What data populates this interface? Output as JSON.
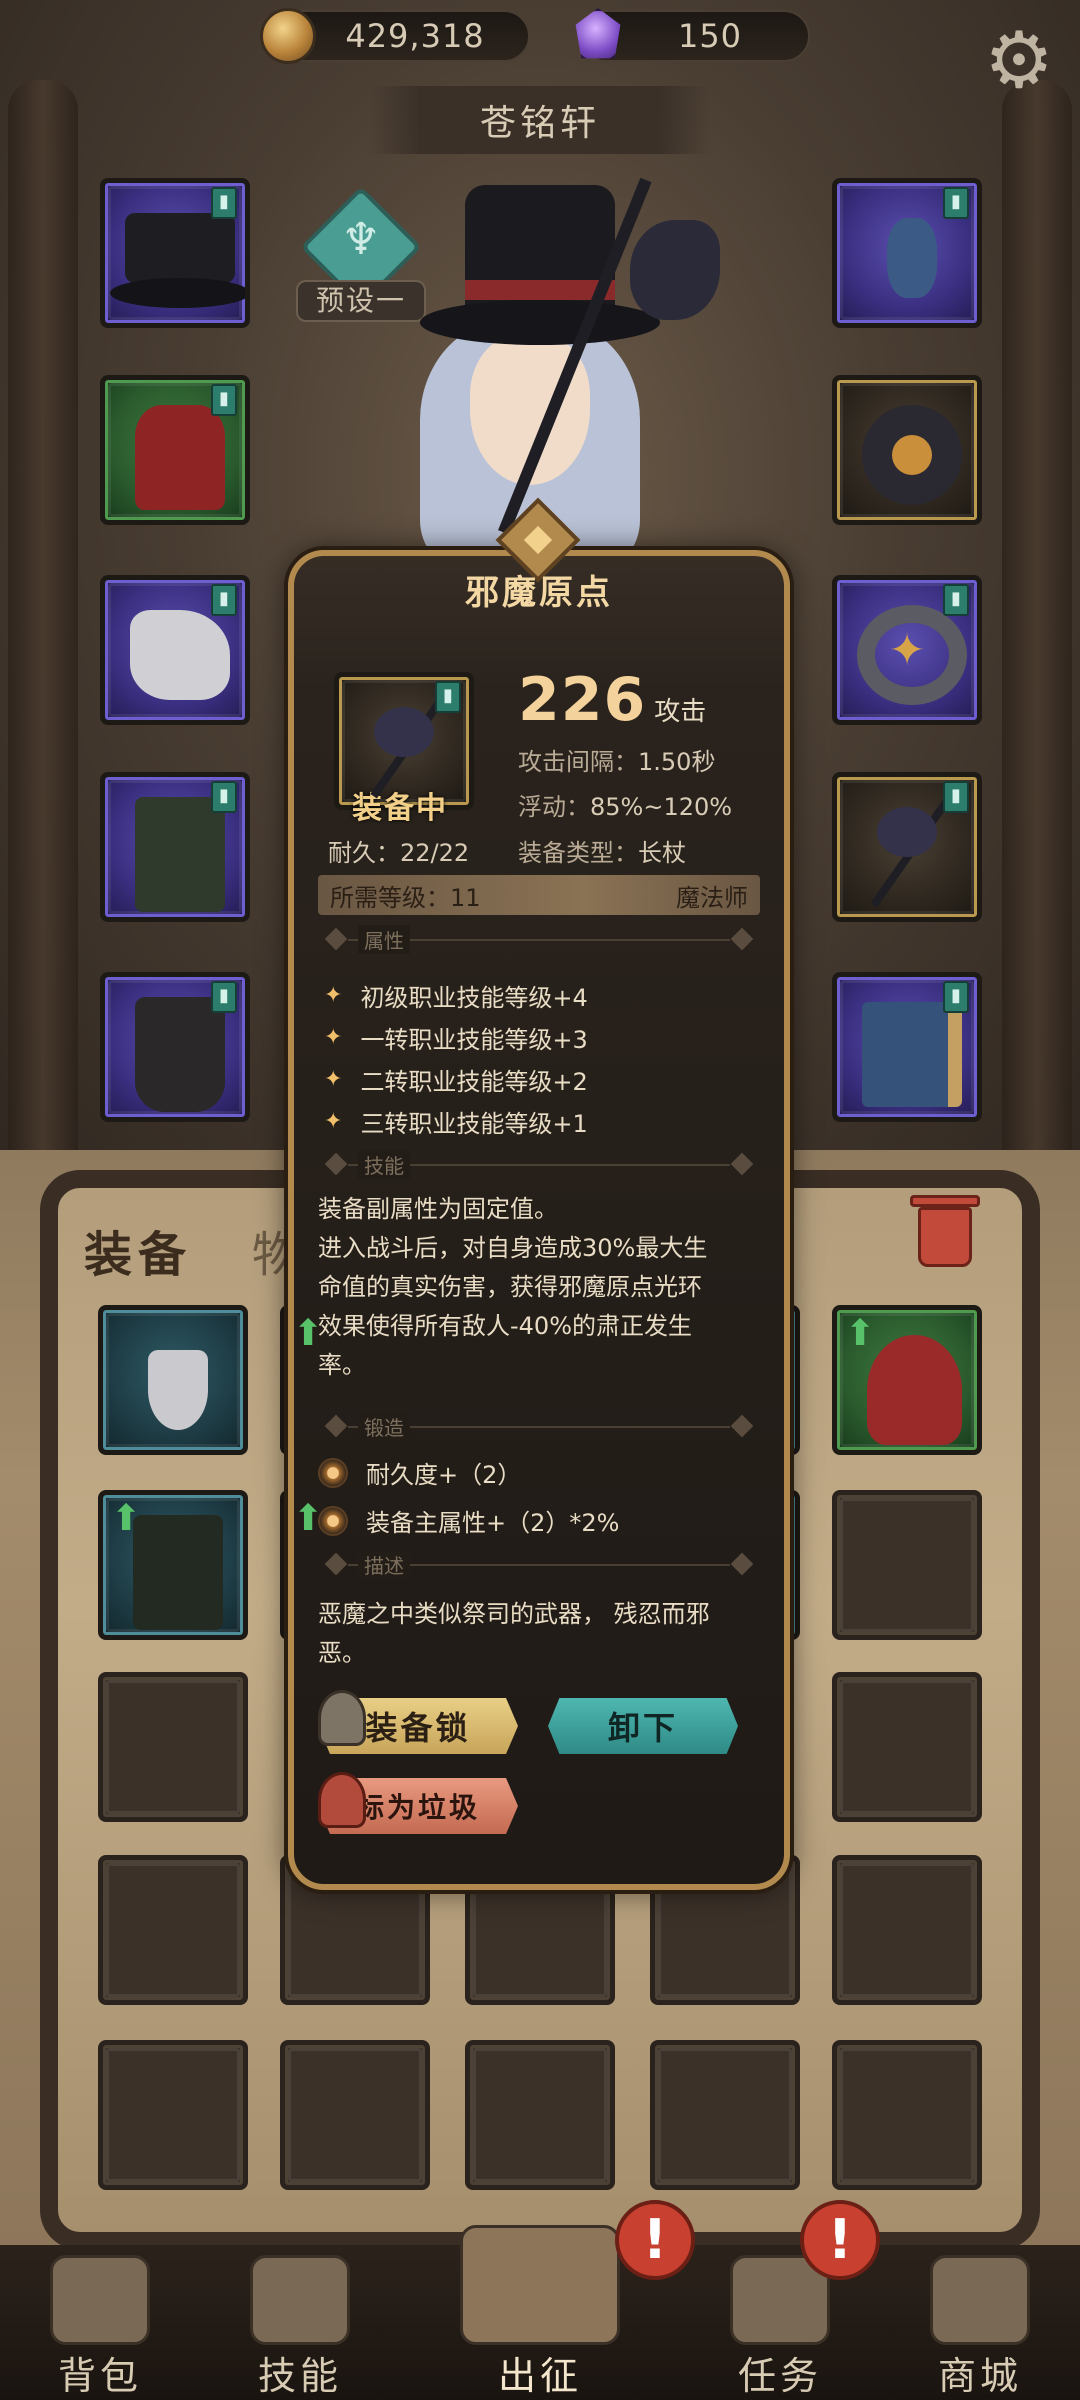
{
  "currency": {
    "gold": "429,318",
    "gems": "150"
  },
  "icons": {
    "gold": "coin-icon",
    "gems": "gem-icon",
    "settings": "gear-icon"
  },
  "character": {
    "name": "苍铭轩",
    "preset_label": "预设一"
  },
  "tabs": {
    "equipment": "装备",
    "items": "物品"
  },
  "tooltip": {
    "title": "邪魔原点",
    "equipped_label": "装备中",
    "durability": "耐久：22/22",
    "attack_value": "226",
    "attack_unit": "攻击",
    "stats": [
      {
        "label": "攻击间隔：",
        "value": "1.50秒"
      },
      {
        "label": "浮动：",
        "value": "85%~120%"
      },
      {
        "label": "装备类型：",
        "value": "长杖"
      }
    ],
    "required_level": "所需等级：11",
    "required_class": "魔法师",
    "section_attributes": "属性",
    "attributes": [
      "初级职业技能等级+4",
      "一转职业技能等级+3",
      "二转职业技能等级+2",
      "三转职业技能等级+1"
    ],
    "section_skill": "技能",
    "skill_text": [
      "装备副属性为固定值。",
      "进入战斗后，对自身造成30%最大生",
      "命值的真实伤害，获得邪魔原点光环",
      "效果使得所有敌人-40%的肃正发生",
      "率。"
    ],
    "section_forge": "锻造",
    "forge": [
      "耐久度+（2）",
      "装备主属性+（2）*2%"
    ],
    "section_desc": "描述",
    "description": [
      "恶魔之中类似祭司的武器， 残忍而邪",
      "恶。"
    ],
    "buttons": {
      "lock": "装备锁",
      "unequip": "卸下",
      "mark_junk": "标为垃圾"
    }
  },
  "nav": {
    "bag": "背包",
    "skills": "技能",
    "expedition": "出征",
    "quests": "任务",
    "shop": "商城",
    "alert_mark": "!"
  },
  "colors": {
    "accent_gold": "#b38a4e",
    "title_gold": "#f4d8a4",
    "unequip_teal": "#3f9f9a",
    "junk_red": "#d07d63",
    "rarity_purple": "#5b4fb0",
    "rarity_green": "#3f7a3f"
  }
}
